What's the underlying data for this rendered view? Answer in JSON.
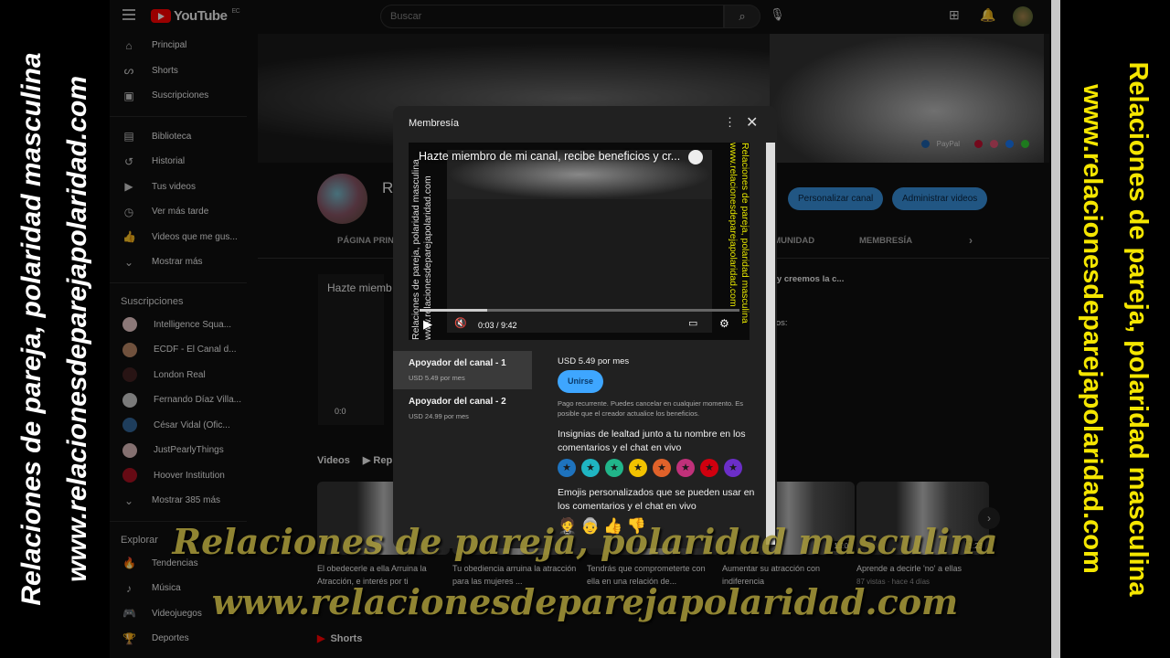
{
  "overlay": {
    "line1": "Relaciones de pareja, polaridad masculina",
    "line2": "www.relacionesdeparejapolaridad.com"
  },
  "topbar": {
    "logo": "YouTube",
    "country": "EC",
    "search_placeholder": "Buscar"
  },
  "sidebar": {
    "main": [
      {
        "label": "Principal",
        "icon": "home-icon"
      },
      {
        "label": "Shorts",
        "icon": "shorts-icon"
      },
      {
        "label": "Suscripciones",
        "icon": "subscriptions-icon"
      }
    ],
    "library": [
      {
        "label": "Biblioteca",
        "icon": "library-icon"
      },
      {
        "label": "Historial",
        "icon": "history-icon"
      },
      {
        "label": "Tus videos",
        "icon": "your-videos-icon"
      },
      {
        "label": "Ver más tarde",
        "icon": "watch-later-icon"
      },
      {
        "label": "Videos que me gus...",
        "icon": "liked-icon"
      },
      {
        "label": "Mostrar más",
        "icon": "chevron-down-icon"
      }
    ],
    "subs_title": "Suscripciones",
    "subs": [
      {
        "label": "Intelligence Squa..."
      },
      {
        "label": "ECDF - El Canal d..."
      },
      {
        "label": "London Real"
      },
      {
        "label": "Fernando Díaz Villa..."
      },
      {
        "label": "César Vidal (Ofic..."
      },
      {
        "label": "JustPearlyThings"
      },
      {
        "label": "Hoover Institution"
      }
    ],
    "show_more_subs": "Mostrar 385 más",
    "explore_title": "Explorar",
    "explore": [
      {
        "label": "Tendencias"
      },
      {
        "label": "Música"
      },
      {
        "label": "Videojuegos"
      },
      {
        "label": "Deportes"
      }
    ]
  },
  "channel": {
    "name": "R",
    "paypal": "PayPal",
    "customize": "Personalizar canal",
    "manage": "Administrar videos",
    "tabs": [
      "PÁGINA PRINCIPAL",
      "COMUNIDAD",
      "MEMBRESÍA"
    ],
    "featured_title": "Hazte miemb",
    "desc1": "s y creemos la c...",
    "desc2": "cios:",
    "featured_time": "0:0"
  },
  "videos": {
    "title": "Videos",
    "play_all": "Rep",
    "items": [
      {
        "title": "El obedecerle a ella Arruina la Atracción, e interés por ti",
        "meta": "",
        "duration": ""
      },
      {
        "title": "Tu obediencia arruina la atracción para las mujeres ...",
        "meta": "",
        "duration": ""
      },
      {
        "title": "Tendrás que comprometerte con ella en una relación de...",
        "meta": "",
        "duration": ""
      },
      {
        "title": "Aumentar su atracción con indiferencia",
        "meta": "",
        "duration": "1:20"
      },
      {
        "title": "Aprende a decirle 'no' a ellas",
        "meta": "87 vistas · hace 4 días",
        "duration": "1:23"
      }
    ]
  },
  "shorts_title": "Shorts",
  "modal": {
    "title": "Membresía",
    "video_title": "Hazte miembro de mi canal, recibe beneficios y cr...",
    "time": "0:03 / 9:42",
    "progress": 0.21,
    "tiers": [
      {
        "name": "Apoyador del canal - 1",
        "price": "USD 5.49 por mes",
        "selected": true
      },
      {
        "name": "Apoyador del canal - 2",
        "price": "USD 24.99 por mes",
        "selected": false
      }
    ],
    "price": "USD 5.49 por mes",
    "join": "Unirse",
    "note": "Pago recurrente. Puedes cancelar en cualquier momento. Es posible que el creador actualice los beneficios.",
    "perk1": "Insignias de lealtad junto a tu nombre en los comentarios y el chat en vivo",
    "badge_colors": [
      "#1e73be",
      "#1fb5c2",
      "#21b58a",
      "#f2c200",
      "#e0622a",
      "#c0317a",
      "#d0000f",
      "#6b2ec8"
    ],
    "perk2": "Emojis personalizados que se pueden usar en los comentarios y el chat en vivo",
    "emojis": [
      "🤵",
      "👵",
      "👍",
      "👎"
    ]
  }
}
